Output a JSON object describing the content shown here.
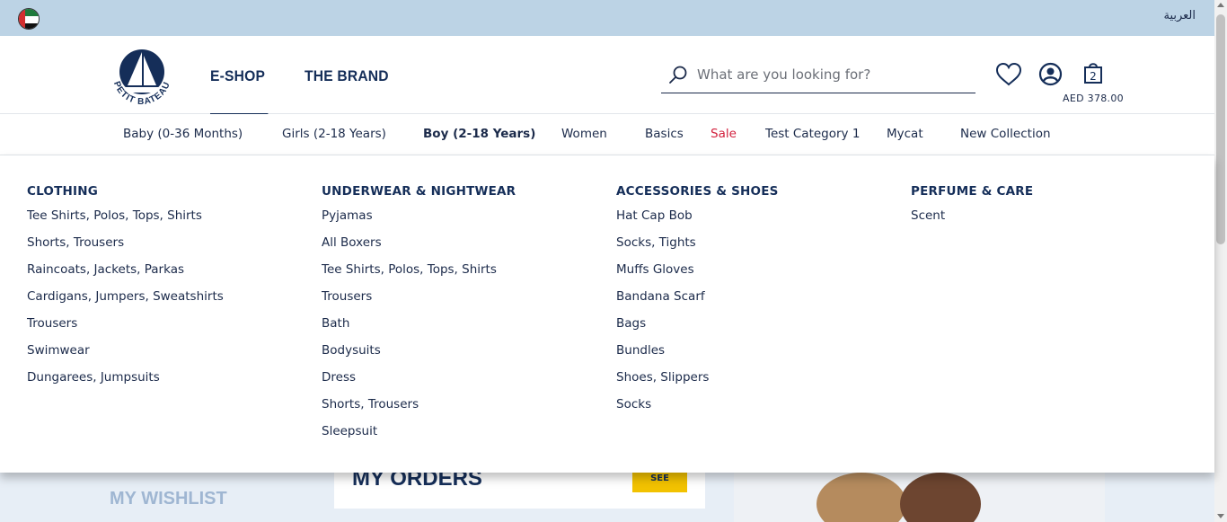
{
  "topbar": {
    "language_link": "العربية",
    "flag": "uae-flag-icon"
  },
  "header": {
    "logo_text": "PETIT BATEAU",
    "main_nav": [
      "E-SHOP",
      "THE BRAND"
    ],
    "search_placeholder": "What are you looking for?",
    "cart_count": "2",
    "cart_total": "AED 378.00"
  },
  "categories": [
    {
      "label": "Baby (0-36 Months)"
    },
    {
      "label": "Girls (2-18 Years)"
    },
    {
      "label": "Boy (2-18 Years)"
    },
    {
      "label": "Women"
    },
    {
      "label": "Basics"
    },
    {
      "label": "Sale"
    },
    {
      "label": "Test Category 1"
    },
    {
      "label": "Mycat"
    },
    {
      "label": "New Collection"
    }
  ],
  "mega_menu": [
    {
      "title": "CLOTHING",
      "items": [
        "Tee Shirts, Polos, Tops, Shirts",
        "Shorts, Trousers",
        "Raincoats, Jackets, Parkas",
        "Cardigans, Jumpers, Sweatshirts",
        "Trousers",
        "Swimwear",
        "Dungarees, Jumpsuits"
      ]
    },
    {
      "title": "UNDERWEAR & NIGHTWEAR",
      "items": [
        "Pyjamas",
        "All Boxers",
        "Tee Shirts, Polos, Tops, Shirts",
        "Trousers",
        "Bath",
        "Bodysuits",
        "Dress",
        "Shorts, Trousers",
        "Sleepsuit"
      ]
    },
    {
      "title": "ACCESSORIES & SHOES",
      "items": [
        "Hat Cap Bob",
        "Socks, Tights",
        "Muffs Gloves",
        "Bandana Scarf",
        "Bags",
        "Bundles",
        "Shoes, Slippers",
        "Socks"
      ]
    },
    {
      "title": "PERFUME & CARE",
      "items": [
        "Scent"
      ]
    }
  ],
  "page_behind": {
    "wishlist_title": "MY WISHLIST",
    "orders_title": "MY ORDERS",
    "orders_button": "SEE"
  },
  "colors": {
    "topbar": "#bcd3e5",
    "navy": "#152e59",
    "sale": "#d21f3c",
    "see_button": "#f2c200"
  }
}
